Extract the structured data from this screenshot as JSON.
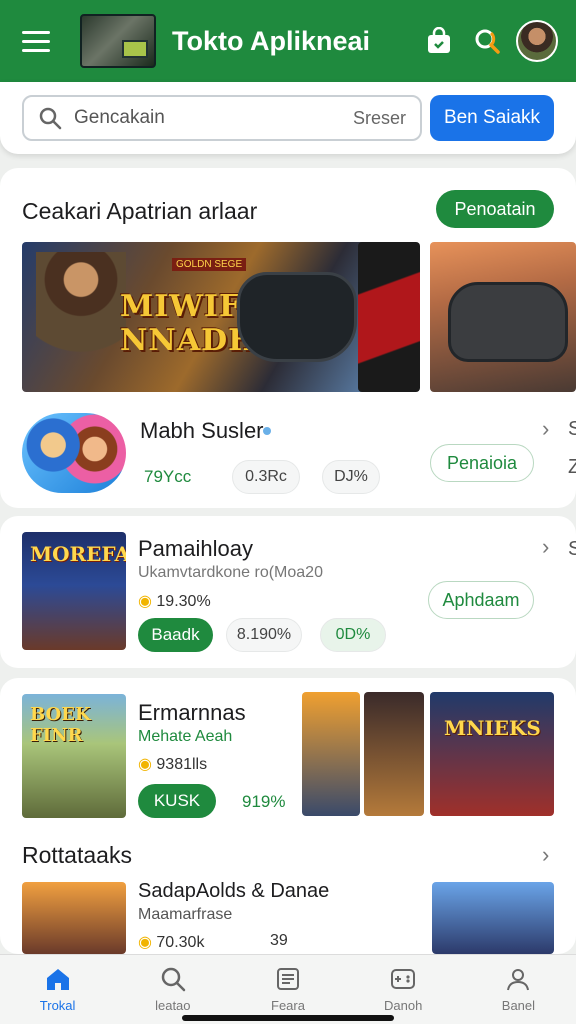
{
  "header": {
    "title": "Tokto Aplikneai",
    "icons": [
      "menu-icon",
      "app-logo",
      "bag-icon",
      "search-icon",
      "avatar"
    ]
  },
  "search": {
    "placeholder": "Gencakain",
    "sub": "Sreser",
    "button": "Ben Saiakk"
  },
  "featured": {
    "title": "Ceakari Apatrian arlaar",
    "action": "Penoatain",
    "banner": {
      "word1": "MIWIFFH",
      "word2": "NNADH",
      "tag": "GOLDN SEGE"
    }
  },
  "app1": {
    "name": "Mabh Susler",
    "rating": "79Ycc",
    "chip1": "0.3Rc",
    "chip2": "DJ%",
    "button": "Penaioia",
    "edge": "S",
    "edge2": "Z"
  },
  "app2": {
    "name": "Pamaihloay",
    "sub": "Ukamvtardkone ro(Moa20",
    "size": "19.30%",
    "install": "Baadk",
    "chip1": "8.190%",
    "chip2": "0D%",
    "button": "Aphdaam",
    "icon_text": "MOREFA",
    "edge": "S"
  },
  "app3": {
    "name": "Ermarnnas",
    "sub": "Mehate Aeah",
    "size": "9381lls",
    "install": "KUSK",
    "percent": "919%",
    "icon_text": "BOEK FINR",
    "shot_text": "MNIEKS"
  },
  "section2": {
    "title": "Rottataaks",
    "app_name": "SadapAolds & Danae",
    "app_sub": "Maamarfrase",
    "size": "70.30k",
    "count": "39"
  },
  "nav": [
    {
      "label": "Trokal",
      "icon": "home-icon",
      "active": true
    },
    {
      "label": "leatao",
      "icon": "search-icon",
      "active": false
    },
    {
      "label": "Feara",
      "icon": "list-icon",
      "active": false
    },
    {
      "label": "Danoh",
      "icon": "games-icon",
      "active": false
    },
    {
      "label": "Banel",
      "icon": "profile-icon",
      "active": false
    }
  ],
  "colors": {
    "primary": "#1f8a3e",
    "accent": "#1a73e8"
  }
}
